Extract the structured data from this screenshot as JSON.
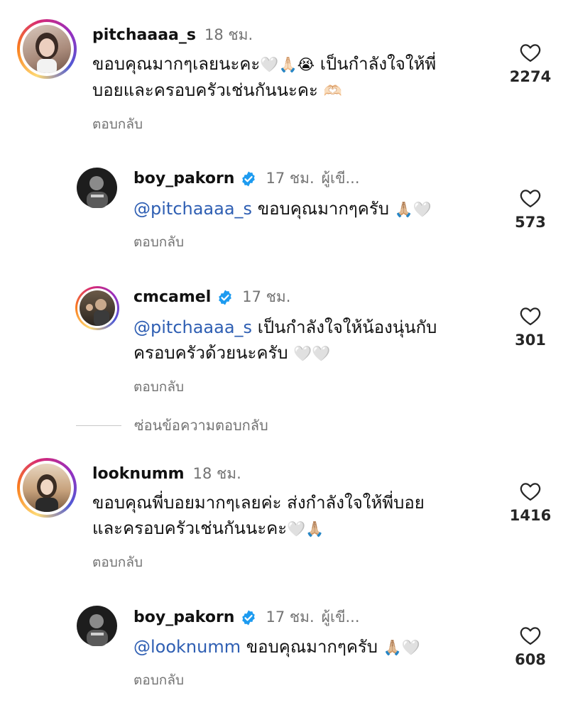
{
  "comments": [
    {
      "username": "pitchaaaa_s",
      "time": "18 ชม.",
      "text": "ขอบคุณมากๆเลยนะคะ🤍🙏🏻😭 เป็นกำลังใจให้พี่บอยและครอบครัวเช่นกันนะคะ 🫶🏻",
      "line1": "ขอบคุณมากๆเลยนะคะ",
      "line1_emoji": "🤍🙏🏻😭",
      "line1_rest": " เป็นกำลังใจให้พี่",
      "line2": "บอยและครอบครัวเช่นกันนะคะ ",
      "line2_emoji": "🫶🏻",
      "reply_label": "ตอบกลับ",
      "likes": "2274"
    },
    {
      "username": "boy_pakorn",
      "time": "17 ชม.",
      "author_tag": "ผู้เขี...",
      "mention": "@pitchaaaa_s",
      "text": " ขอบคุณมากๆครับ ",
      "emoji": "🙏🏼🤍",
      "reply_label": "ตอบกลับ",
      "likes": "573"
    },
    {
      "username": "cmcamel",
      "time": "17 ชม.",
      "mention": "@pitchaaaa_s",
      "line1_rest": " เป็นกำลังใจให้น้องนุ่นกับ",
      "line2": "ครอบครัวด้วยนะครับ ",
      "line2_emoji": "🤍🤍",
      "reply_label": "ตอบกลับ",
      "likes": "301"
    },
    {
      "username": "looknumm",
      "time": "18 ชม.",
      "line1": "ขอบคุณพี่บอยมากๆเลยค่ะ ส่งกำลังใจให้พี่บอย",
      "line2": "และครอบครัวเช่นกันนะคะ",
      "line2_emoji": "🤍🙏🏼",
      "reply_label": "ตอบกลับ",
      "likes": "1416"
    },
    {
      "username": "boy_pakorn",
      "time": "17 ชม.",
      "author_tag": "ผู้เขี...",
      "mention": "@looknumm",
      "text": " ขอบคุณมากๆครับ ",
      "emoji": "🙏🏼🤍",
      "reply_label": "ตอบกลับ",
      "likes": "608"
    }
  ],
  "hide_replies": "ซ่อนข้อความตอบกลับ",
  "icons": {
    "like": "heart-outline-icon",
    "verified": "verified-badge-icon"
  },
  "colors": {
    "verified": "#1d9bf0",
    "mention": "#2f5fb3",
    "muted": "#737373"
  }
}
